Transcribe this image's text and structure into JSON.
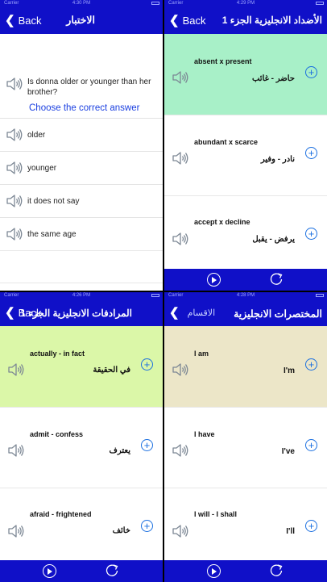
{
  "status": {
    "carrier": "Carrier",
    "time1": "4:30 PM",
    "time2": "4:29 PM",
    "time3": "4:26 PM",
    "time4": "4:28 PM"
  },
  "quiz": {
    "back_label": "Back",
    "title": "الاختبار",
    "question": "Is donna older or younger than her brother?",
    "instruction": "Choose the correct answer",
    "options": [
      "older",
      "younger",
      "it does not say",
      "the same age"
    ]
  },
  "antonyms": {
    "back_label": "Back",
    "title": "الأضداد الانجليزية الجزء 1",
    "rows": [
      {
        "en": "absent x present",
        "ar": "حاضر - غائب"
      },
      {
        "en": "abundant x scarce",
        "ar": "نادر - وفير"
      },
      {
        "en": "accept x decline",
        "ar": "يرفض - يقبل"
      }
    ]
  },
  "synonyms": {
    "back_label": "Back",
    "title": "المرادفات الانجليزية الجزء 1",
    "rows": [
      {
        "en": "actually - in fact",
        "ar": "في الحقيقة"
      },
      {
        "en": "admit - confess",
        "ar": "يعترف"
      },
      {
        "en": "afraid - frightened",
        "ar": "خائف"
      }
    ]
  },
  "abbreviations": {
    "back_label": "الاقسام",
    "title": "المختصرات الانجليزية",
    "rows": [
      {
        "en": "I am",
        "short": "I'm"
      },
      {
        "en": "I have",
        "short": "I've"
      },
      {
        "en": "I will - I shall",
        "short": "I'll"
      }
    ]
  },
  "colors": {
    "nav": "#1010c8",
    "highlight_green": "#a8f0c8",
    "highlight_lime": "#dbf7a8",
    "highlight_beige": "#ece6c8",
    "link_blue": "#1a6fe0"
  },
  "icons": [
    "speaker-icon",
    "plus-circle-icon",
    "play-icon",
    "repeat-icon",
    "chevron-left-icon"
  ]
}
